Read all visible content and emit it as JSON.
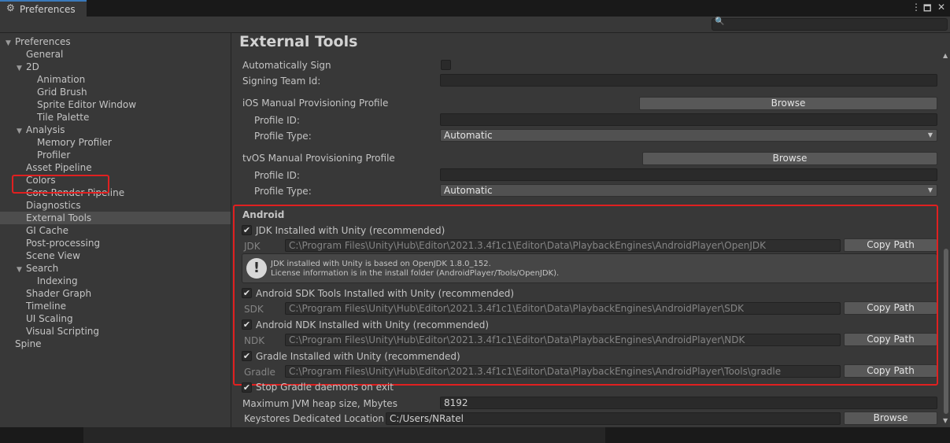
{
  "window": {
    "title": "Preferences"
  },
  "sidebar": {
    "items": [
      {
        "label": "Preferences",
        "level": 0,
        "expanded": true
      },
      {
        "label": "General",
        "level": 1
      },
      {
        "label": "2D",
        "level": 1,
        "expanded": true
      },
      {
        "label": "Animation",
        "level": 2
      },
      {
        "label": "Grid Brush",
        "level": 2
      },
      {
        "label": "Sprite Editor Window",
        "level": 2
      },
      {
        "label": "Tile Palette",
        "level": 2
      },
      {
        "label": "Analysis",
        "level": 1,
        "expanded": true
      },
      {
        "label": "Memory Profiler",
        "level": 2
      },
      {
        "label": "Profiler",
        "level": 2
      },
      {
        "label": "Asset Pipeline",
        "level": 1
      },
      {
        "label": "Colors",
        "level": 1
      },
      {
        "label": "Core Render Pipeline",
        "level": 1
      },
      {
        "label": "Diagnostics",
        "level": 1
      },
      {
        "label": "External Tools",
        "level": 1,
        "selected": true
      },
      {
        "label": "GI Cache",
        "level": 1
      },
      {
        "label": "Post-processing",
        "level": 1
      },
      {
        "label": "Scene View",
        "level": 1
      },
      {
        "label": "Search",
        "level": 1,
        "expanded": true
      },
      {
        "label": "Indexing",
        "level": 2
      },
      {
        "label": "Shader Graph",
        "level": 1
      },
      {
        "label": "Timeline",
        "level": 1
      },
      {
        "label": "UI Scaling",
        "level": 1
      },
      {
        "label": "Visual Scripting",
        "level": 1
      },
      {
        "label": "Spine",
        "level": 0
      }
    ]
  },
  "main": {
    "title": "External Tools",
    "ios": {
      "auto_sign_label": "Automatically Sign",
      "auto_sign_checked": false,
      "signing_team_label": "Signing Team Id:",
      "signing_team_value": "",
      "manual_profile_label": "iOS Manual Provisioning Profile",
      "browse_label": "Browse",
      "profile_id_label": "Profile ID:",
      "profile_id_value": "",
      "profile_type_label": "Profile Type:",
      "profile_type_value": "Automatic"
    },
    "tvos": {
      "manual_profile_label": "tvOS Manual Provisioning Profile",
      "browse_label": "Browse",
      "profile_id_label": "Profile ID:",
      "profile_id_value": "",
      "profile_type_label": "Profile Type:",
      "profile_type_value": "Automatic"
    },
    "android": {
      "header": "Android",
      "jdk": {
        "checkbox_label": "JDK Installed with Unity (recommended)",
        "checked": true,
        "field_label": "JDK",
        "path": "C:\\Program Files\\Unity\\Hub\\Editor\\2021.3.4f1c1\\Editor\\Data\\PlaybackEngines\\AndroidPlayer\\OpenJDK",
        "copy_label": "Copy Path"
      },
      "help": {
        "line1": "JDK installed with Unity is based on OpenJDK 1.8.0_152.",
        "line2": "License information is in the install folder (AndroidPlayer/Tools/OpenJDK)."
      },
      "sdk": {
        "checkbox_label": "Android SDK Tools Installed with Unity (recommended)",
        "checked": true,
        "field_label": "SDK",
        "path": "C:\\Program Files\\Unity\\Hub\\Editor\\2021.3.4f1c1\\Editor\\Data\\PlaybackEngines\\AndroidPlayer\\SDK",
        "copy_label": "Copy Path"
      },
      "ndk": {
        "checkbox_label": "Android NDK Installed with Unity (recommended)",
        "checked": true,
        "field_label": "NDK",
        "path": "C:\\Program Files\\Unity\\Hub\\Editor\\2021.3.4f1c1\\Editor\\Data\\PlaybackEngines\\AndroidPlayer\\NDK",
        "copy_label": "Copy Path"
      },
      "gradle": {
        "checkbox_label": "Gradle Installed with Unity (recommended)",
        "checked": true,
        "field_label": "Gradle",
        "path": "C:\\Program Files\\Unity\\Hub\\Editor\\2021.3.4f1c1\\Editor\\Data\\PlaybackEngines\\AndroidPlayer\\Tools\\gradle",
        "copy_label": "Copy Path"
      },
      "stop_gradle_label": "Stop Gradle daemons on exit",
      "stop_gradle_checked": true,
      "jvm_heap_label": "Maximum JVM heap size, Mbytes",
      "jvm_heap_value": "8192",
      "keystores_label": "Keystores Dedicated Location",
      "keystores_value": "C:/Users/NRatel",
      "keystores_browse_label": "Browse"
    }
  },
  "icons": {
    "gear": "⚙",
    "menu": "⋮",
    "maximize": "🗖",
    "close": "✕",
    "search": "🔍",
    "check": "✔",
    "warning": "!",
    "arrow_expanded": "▼",
    "caret_down": "▼",
    "scroll_up": "▲",
    "scroll_down": "▼"
  },
  "colors": {
    "selection_highlight": "#e02020",
    "accent_tab": "#3a79bb"
  }
}
